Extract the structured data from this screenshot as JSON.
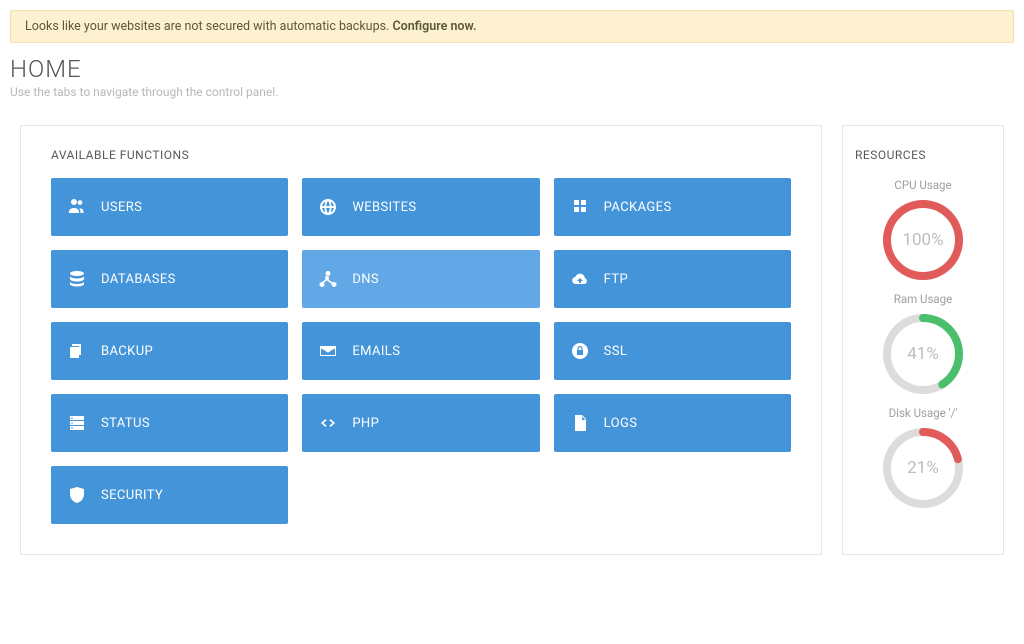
{
  "alert": {
    "text": "Looks like your websites are not secured with automatic backups. ",
    "link": "Configure now."
  },
  "header": {
    "title": "HOME",
    "subtitle": "Use the tabs to navigate through the control panel."
  },
  "functions": {
    "title": "AVAILABLE FUNCTIONS",
    "items": [
      {
        "label": "USERS",
        "icon": "users-icon"
      },
      {
        "label": "WEBSITES",
        "icon": "globe-icon"
      },
      {
        "label": "PACKAGES",
        "icon": "packages-icon"
      },
      {
        "label": "DATABASES",
        "icon": "database-icon"
      },
      {
        "label": "DNS",
        "icon": "network-icon",
        "hover": true
      },
      {
        "label": "FTP",
        "icon": "cloud-icon"
      },
      {
        "label": "BACKUP",
        "icon": "copy-icon"
      },
      {
        "label": "EMAILS",
        "icon": "mail-icon"
      },
      {
        "label": "SSL",
        "icon": "lock-icon"
      },
      {
        "label": "STATUS",
        "icon": "server-icon"
      },
      {
        "label": "PHP",
        "icon": "code-icon"
      },
      {
        "label": "LOGS",
        "icon": "file-icon"
      },
      {
        "label": "SECURITY",
        "icon": "shield-icon"
      }
    ]
  },
  "resources": {
    "title": "RESOURCES",
    "gauges": [
      {
        "label": "CPU Usage",
        "value": 100,
        "display": "100%",
        "color": "#e15b5b"
      },
      {
        "label": "Ram Usage",
        "value": 41,
        "display": "41%",
        "color": "#4bbf6b"
      },
      {
        "label": "Disk Usage '/'",
        "value": 21,
        "display": "21%",
        "color": "#e15b5b"
      }
    ]
  }
}
